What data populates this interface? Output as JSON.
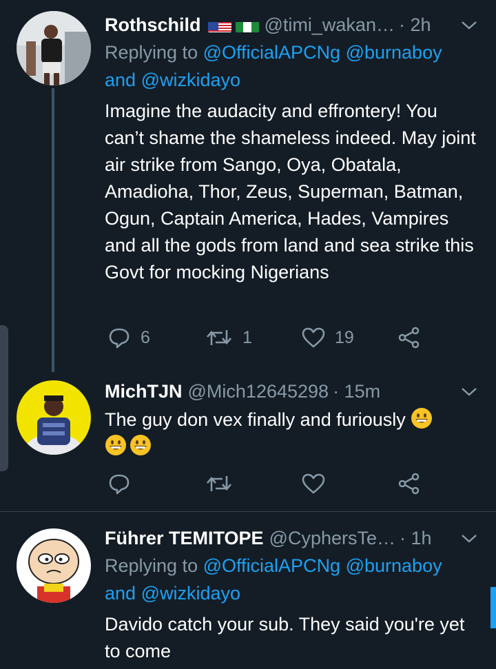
{
  "colors": {
    "background": "#141d26",
    "accent": "#1da1f2",
    "muted": "#8899a6",
    "divider": "#38444d"
  },
  "tweets": [
    {
      "name": "Rothschild",
      "flags": [
        "us-flag-icon",
        "nigeria-flag-icon"
      ],
      "handle": "@timi_wakan…",
      "time": "· 2h",
      "reply_prefix": "Replying to",
      "mention1": "@OfficialAPCNg",
      "mention2": "@burnaboy",
      "and": "and",
      "mention3": "@wizkidayo",
      "text": "Imagine the audacity and effrontery! You can’t shame the shameless indeed. May joint air strike from Sango, Oya, Obatala, Amadioha, Thor, Zeus, Superman, Batman, Ogun, Captain America, Hades, Vampires and all the gods from land and sea strike this Govt for mocking Nigerians",
      "replies": "6",
      "retweets": "1",
      "likes": "19"
    },
    {
      "name": "MichTJN",
      "handle": "@Mich12645298",
      "time": "· 15m",
      "text": "The guy don vex finally and furiously",
      "emojis": [
        "grinning-emoji",
        "grinning-emoji",
        "grinning-emoji"
      ]
    },
    {
      "name": "Führer TEMITOPE",
      "handle": "@CyphersTe…",
      "time": "· 1h",
      "reply_prefix": "Replying to",
      "mention1": "@OfficialAPCNg",
      "mention2": "@burnaboy",
      "and": "and",
      "mention3": "@wizkidayo",
      "text": "Davido catch your sub. They said you're yet to come"
    }
  ]
}
